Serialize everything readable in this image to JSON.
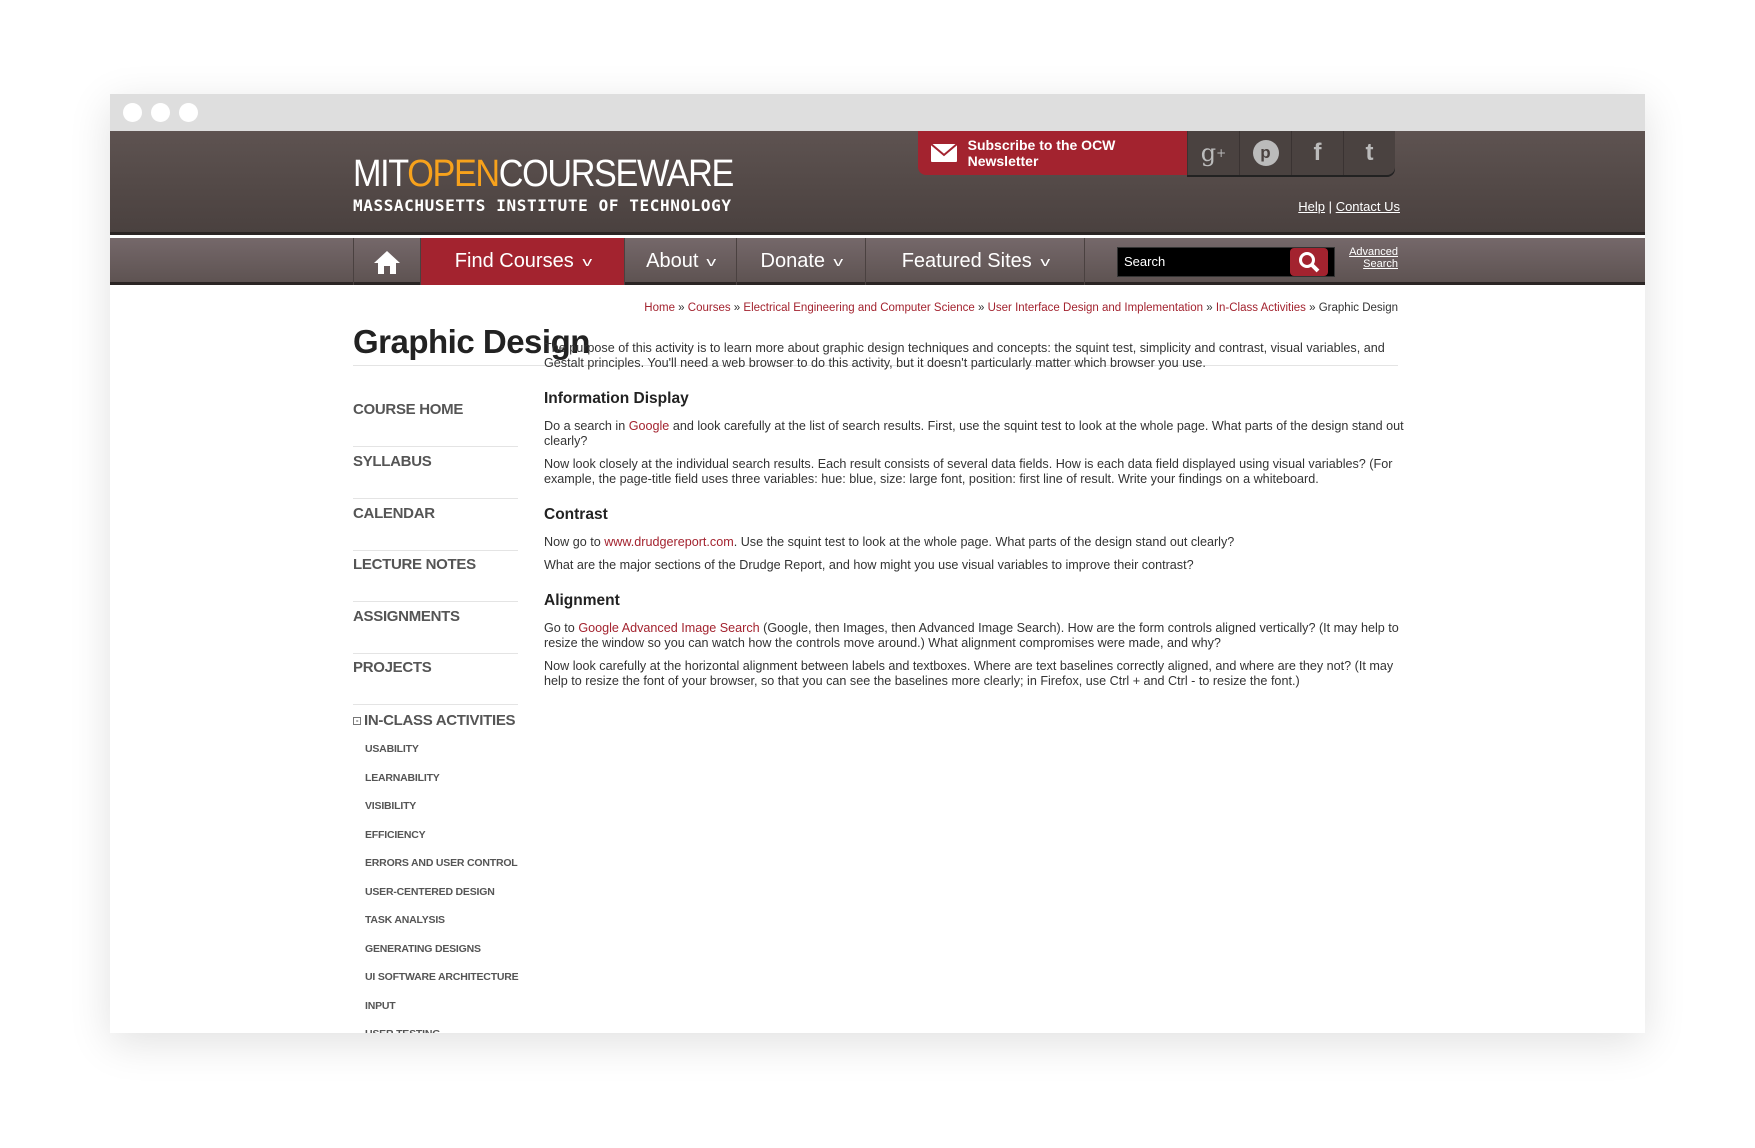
{
  "header": {
    "logo_mit": "MIT",
    "logo_open": "OPEN",
    "logo_courseware": "COURSEWARE",
    "logo_sub": "MASSACHUSETTS INSTITUTE OF TECHNOLOGY",
    "subscribe": "Subscribe to the OCW Newsletter",
    "social": [
      "google-plus-icon",
      "pinterest-icon",
      "facebook-icon",
      "twitter-icon"
    ],
    "help": "Help",
    "sep": "|",
    "contact": "Contact Us"
  },
  "nav": {
    "items": [
      {
        "label": "Find Courses"
      },
      {
        "label": "About"
      },
      {
        "label": "Donate"
      },
      {
        "label": "Featured Sites"
      }
    ],
    "search_placeholder": "Search",
    "advanced1": "Advanced",
    "advanced2": "Search"
  },
  "breadcrumb": {
    "items": [
      "Home",
      "Courses",
      "Electrical Engineering and Computer Science",
      "User Interface Design and Implementation",
      "In-Class Activities"
    ],
    "sep": " » ",
    "current": "Graphic Design"
  },
  "page": {
    "title": "Graphic Design"
  },
  "sidebar": {
    "items": [
      "COURSE HOME",
      "SYLLABUS",
      "CALENDAR",
      "LECTURE NOTES",
      "ASSIGNMENTS",
      "PROJECTS"
    ],
    "section": "IN-CLASS ACTIVITIES",
    "sub": [
      "USABILITY",
      "LEARNABILITY",
      "VISIBILITY",
      "EFFICIENCY",
      "ERRORS AND USER CONTROL",
      "USER-CENTERED DESIGN",
      "TASK ANALYSIS",
      "GENERATING DESIGNS",
      "UI SOFTWARE ARCHITECTURE",
      "INPUT",
      "USER TESTING"
    ]
  },
  "content": {
    "intro": "The purpose of this activity is to learn more about graphic design techniques and concepts: the squint test, simplicity and contrast, visual variables, and Gestalt principles. You'll need a web browser to do this activity, but it doesn't particularly matter which browser you use.",
    "h1": "Information Display",
    "p1a": "Do a search in ",
    "p1link": "Google",
    "p1b": " and look carefully at the list of search results. First, use the squint test to look at the whole page. What parts of the design stand out clearly?",
    "p2": "Now look closely at the individual search results. Each result consists of several data fields. How is each data field displayed using visual variables? (For example, the page-title field uses three variables: hue: blue, size: large font, position: first line of result. Write your findings on a whiteboard.",
    "h2": "Contrast",
    "p3a": "Now go to ",
    "p3link": "www.drudgereport.com",
    "p3b": ". Use the squint test to look at the whole page. What parts of the design stand out clearly?",
    "p4": "What are the major sections of the Drudge Report, and how might you use visual variables to improve their contrast?",
    "h3": "Alignment",
    "p5a": "Go to ",
    "p5link": "Google Advanced Image Search",
    "p5b": " (Google, then Images, then Advanced Image Search). How are the form controls aligned vertically? (It may help to resize the window so you can watch how the controls move around.) What alignment compromises were made, and why?",
    "p6": "Now look carefully at the horizontal alignment between labels and textboxes. Where are text baselines correctly aligned, and where are they not? (It may help to resize the font of your browser, so that you can see the baselines more clearly; in Firefox, use Ctrl + and Ctrl - to resize the font.)"
  },
  "colors": {
    "brand_red": "#a3232f",
    "header_brown": "#5e5351",
    "logo_orange": "#f7a21c"
  }
}
